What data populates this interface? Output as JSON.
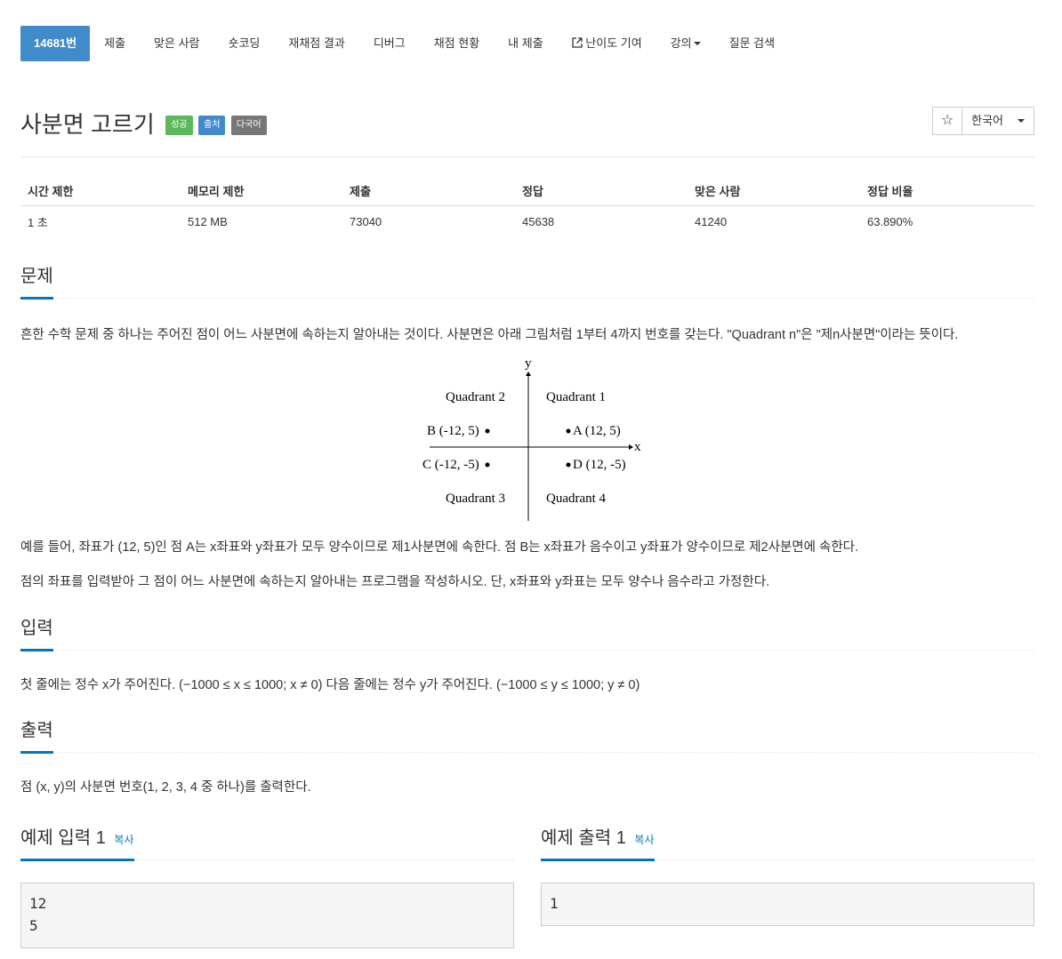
{
  "tabs": [
    {
      "label": "14681번",
      "active": true
    },
    {
      "label": "제출"
    },
    {
      "label": "맞은 사람"
    },
    {
      "label": "숏코딩"
    },
    {
      "label": "재채점 결과"
    },
    {
      "label": "디버그"
    },
    {
      "label": "채점 현황"
    },
    {
      "label": "내 제출"
    },
    {
      "label": "난이도 기여",
      "icon": "external-link-icon"
    },
    {
      "label": "강의",
      "dropdown": true
    },
    {
      "label": "질문 검색"
    }
  ],
  "problem": {
    "title": "사분면 고르기",
    "labels": {
      "success": "성공",
      "source": "출처",
      "multilang": "다국어"
    },
    "star_glyph": "☆",
    "language": "한국어"
  },
  "info": {
    "headers": [
      "시간 제한",
      "메모리 제한",
      "제출",
      "정답",
      "맞은 사람",
      "정답 비율"
    ],
    "values": [
      "1 초",
      "512 MB",
      "73040",
      "45638",
      "41240",
      "63.890%"
    ]
  },
  "sections": {
    "problem_title": "문제",
    "problem_text1": "흔한 수학 문제 중 하나는 주어진 점이 어느 사분면에 속하는지 알아내는 것이다. 사분면은 아래 그림처럼 1부터 4까지 번호를 갖는다. \"Quadrant n\"은 \"제n사분면\"이라는 뜻이다.",
    "problem_text2": "예를 들어, 좌표가 (12, 5)인 점 A는 x좌표와 y좌표가 모두 양수이므로 제1사분면에 속한다. 점 B는 x좌표가 음수이고 y좌표가 양수이므로 제2사분면에 속한다.",
    "problem_text3": "점의 좌표를 입력받아 그 점이 어느 사분면에 속하는지 알아내는 프로그램을 작성하시오. 단, x좌표와 y좌표는 모두 양수나 음수라고 가정한다.",
    "input_title": "입력",
    "input_text": "첫 줄에는 정수 x가 주어진다. (−1000 ≤ x ≤ 1000; x ≠ 0) 다음 줄에는 정수 y가 주어진다. (−1000 ≤ y ≤ 1000; y ≠ 0)",
    "output_title": "출력",
    "output_text": "점 (x, y)의 사분면 번호(1, 2, 3, 4 중 하나)를 출력한다."
  },
  "figure": {
    "y_label": "y",
    "x_label": "x",
    "q1": "Quadrant 1",
    "q2": "Quadrant 2",
    "q3": "Quadrant 3",
    "q4": "Quadrant 4",
    "A": "A (12, 5)",
    "B": "B (-12, 5)",
    "C": "C (-12, -5)",
    "D": "D (12, -5)"
  },
  "samples": {
    "input_title": "예제 입력 1",
    "output_title": "예제 출력 1",
    "copy_label": "복사",
    "input_value": "12\n5",
    "output_value": "1"
  }
}
